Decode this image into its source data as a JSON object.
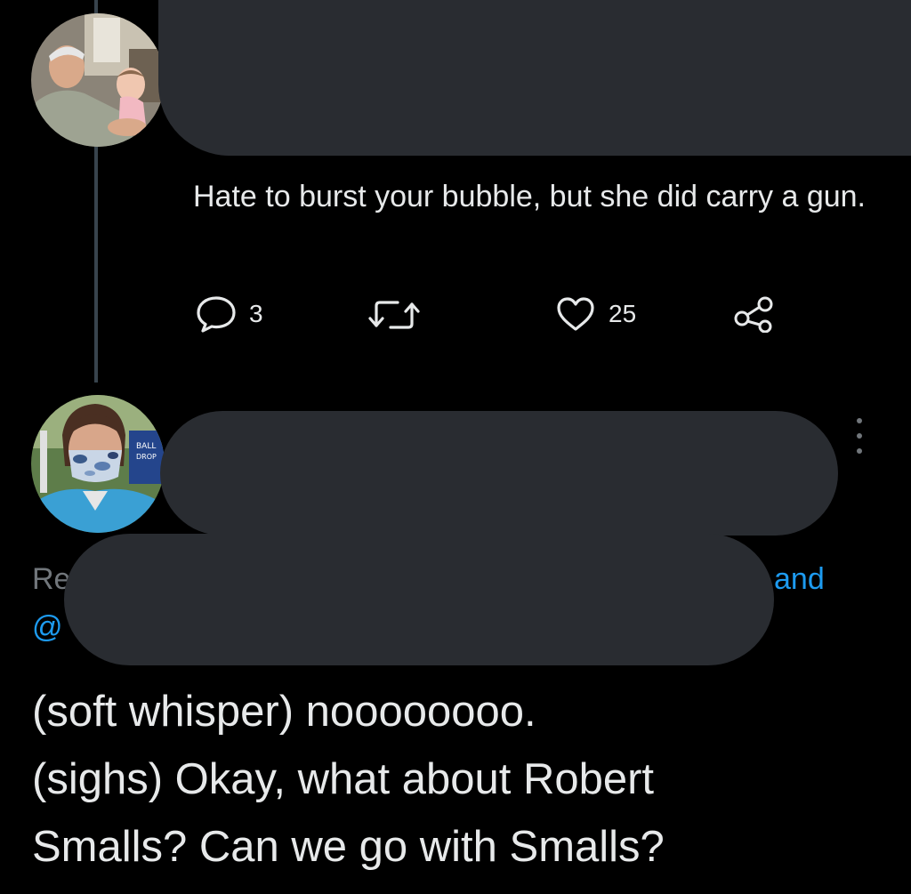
{
  "tweet": {
    "text": "Hate to burst your bubble, but she did carry a gun.",
    "replies_count": "3",
    "likes_count": "25"
  },
  "reply": {
    "replying_to_visible_start": "Re",
    "replying_to_visible_end": "and",
    "handle_visible_start": "@",
    "text_lines": [
      "(soft whisper) noooooooo.",
      "(sighs) Okay, what about Robert",
      "Smalls? Can we go with Smalls?"
    ]
  },
  "icons": {
    "reply": "reply-bubble-icon",
    "retweet": "retweet-icon",
    "like": "heart-icon",
    "share": "share-icon",
    "more": "more-options-icon"
  },
  "colors": {
    "background": "#000000",
    "text": "#e7e9ea",
    "muted": "#71767b",
    "link": "#1d9bf0",
    "redaction": "#292c31",
    "thread_line": "#38444d"
  }
}
